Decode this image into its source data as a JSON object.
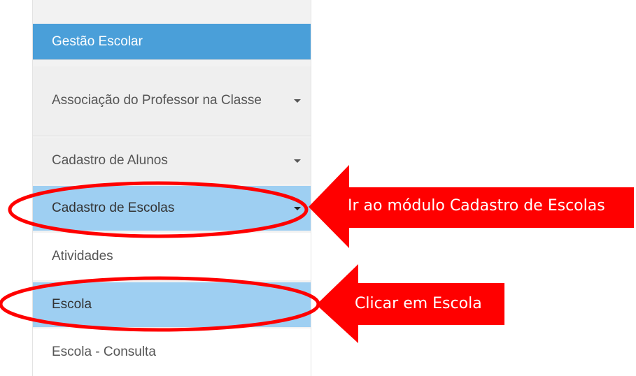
{
  "sidebar": {
    "items": [
      {
        "label": "Gestão Escolar",
        "state": "header"
      },
      {
        "label": "Associação do Professor na Classe",
        "state": "collapsed",
        "icon": "chevron-down-icon"
      },
      {
        "label": "Cadastro de Alunos",
        "state": "collapsed",
        "icon": "chevron-down-icon"
      },
      {
        "label": "Cadastro de Escolas",
        "state": "highlighted",
        "icon": "chevron-down-icon"
      },
      {
        "label": "Atividades",
        "state": "normal"
      },
      {
        "label": "Escola",
        "state": "highlighted"
      },
      {
        "label": "Escola - Consulta",
        "state": "normal"
      }
    ]
  },
  "annotations": {
    "callout1": "Ir ao módulo Cadastro de Escolas",
    "callout2": "Clicar em Escola"
  },
  "colors": {
    "header_bg": "#4a9fd9",
    "highlight_bg": "#9ecff2",
    "annotation_red": "#ff0000",
    "menu_bg": "#efefef"
  }
}
